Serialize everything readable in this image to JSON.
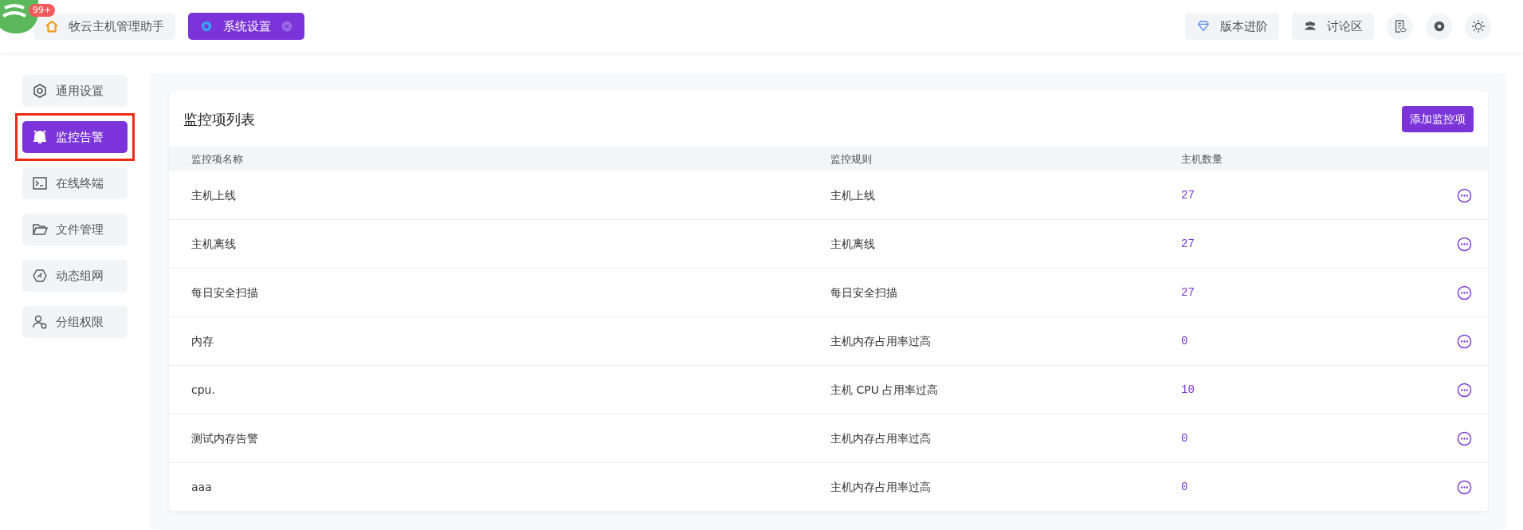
{
  "app_badge": "99+",
  "tabs": [
    {
      "label": "牧云主机管理助手",
      "kind": "home",
      "selected": false,
      "closable": false
    },
    {
      "label": "系统设置",
      "kind": "settings",
      "selected": true,
      "closable": true
    }
  ],
  "toolbar": [
    {
      "kind": "upgrade",
      "label": "版本进阶"
    },
    {
      "kind": "forum",
      "label": "讨论区"
    },
    {
      "kind": "log"
    },
    {
      "kind": "settings"
    },
    {
      "kind": "theme"
    }
  ],
  "sidebar": {
    "items": [
      {
        "label": "通用设置",
        "kind": "hexagon",
        "selected": false,
        "highlighted": false
      },
      {
        "label": "监控告警",
        "kind": "bell",
        "selected": true,
        "highlighted": true
      },
      {
        "label": "在线终端",
        "kind": "terminal",
        "selected": false,
        "highlighted": false
      },
      {
        "label": "文件管理",
        "kind": "folder",
        "selected": false,
        "highlighted": false
      },
      {
        "label": "动态组网",
        "kind": "network",
        "selected": false,
        "highlighted": false
      },
      {
        "label": "分组权限",
        "kind": "users",
        "selected": false,
        "highlighted": false
      }
    ]
  },
  "panel": {
    "title": "监控项列表",
    "add_button": "添加监控项"
  },
  "table": {
    "columns": [
      "监控项名称",
      "监控规则",
      "主机数量"
    ],
    "rows": [
      {
        "name": "主机上线",
        "rule": "主机上线",
        "hosts": "27"
      },
      {
        "name": "主机离线",
        "rule": "主机离线",
        "hosts": "27"
      },
      {
        "name": "每日安全扫描",
        "rule": "每日安全扫描",
        "hosts": "27"
      },
      {
        "name": "内存",
        "rule": "主机内存占用率过高",
        "hosts": "0"
      },
      {
        "name": "cpu.",
        "rule": "主机 CPU 占用率过高",
        "hosts": "10"
      },
      {
        "name": "测试内存告警",
        "rule": "主机内存占用率过高",
        "hosts": "0"
      },
      {
        "name": "aaa",
        "rule": "主机内存占用率过高",
        "hosts": "0"
      }
    ]
  }
}
